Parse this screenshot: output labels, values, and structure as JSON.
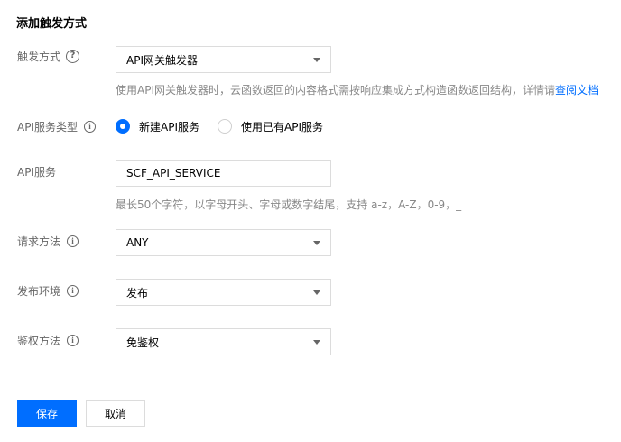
{
  "page": {
    "title": "添加触发方式"
  },
  "trigger_type": {
    "label": "触发方式",
    "selected": "API网关触发器",
    "hint": "使用API网关触发器时，云函数返回的内容格式需按响应集成方式构造函数返回结构，详情请",
    "hint_link": "查阅文档"
  },
  "api_service_type": {
    "label": "API服务类型",
    "options": [
      {
        "label": "新建API服务",
        "checked": true
      },
      {
        "label": "使用已有API服务",
        "checked": false
      }
    ]
  },
  "api_service": {
    "label": "API服务",
    "value": "SCF_API_SERVICE",
    "hint": "最长50个字符，以字母开头、字母或数字结尾，支持 a-z，A-Z，0-9，_"
  },
  "request_method": {
    "label": "请求方法",
    "selected": "ANY"
  },
  "release_env": {
    "label": "发布环境",
    "selected": "发布"
  },
  "auth_method": {
    "label": "鉴权方法",
    "selected": "免鉴权"
  },
  "footer": {
    "save_label": "保存",
    "cancel_label": "取消"
  },
  "colors": {
    "primary": "#006eff",
    "link": "#006eff"
  }
}
